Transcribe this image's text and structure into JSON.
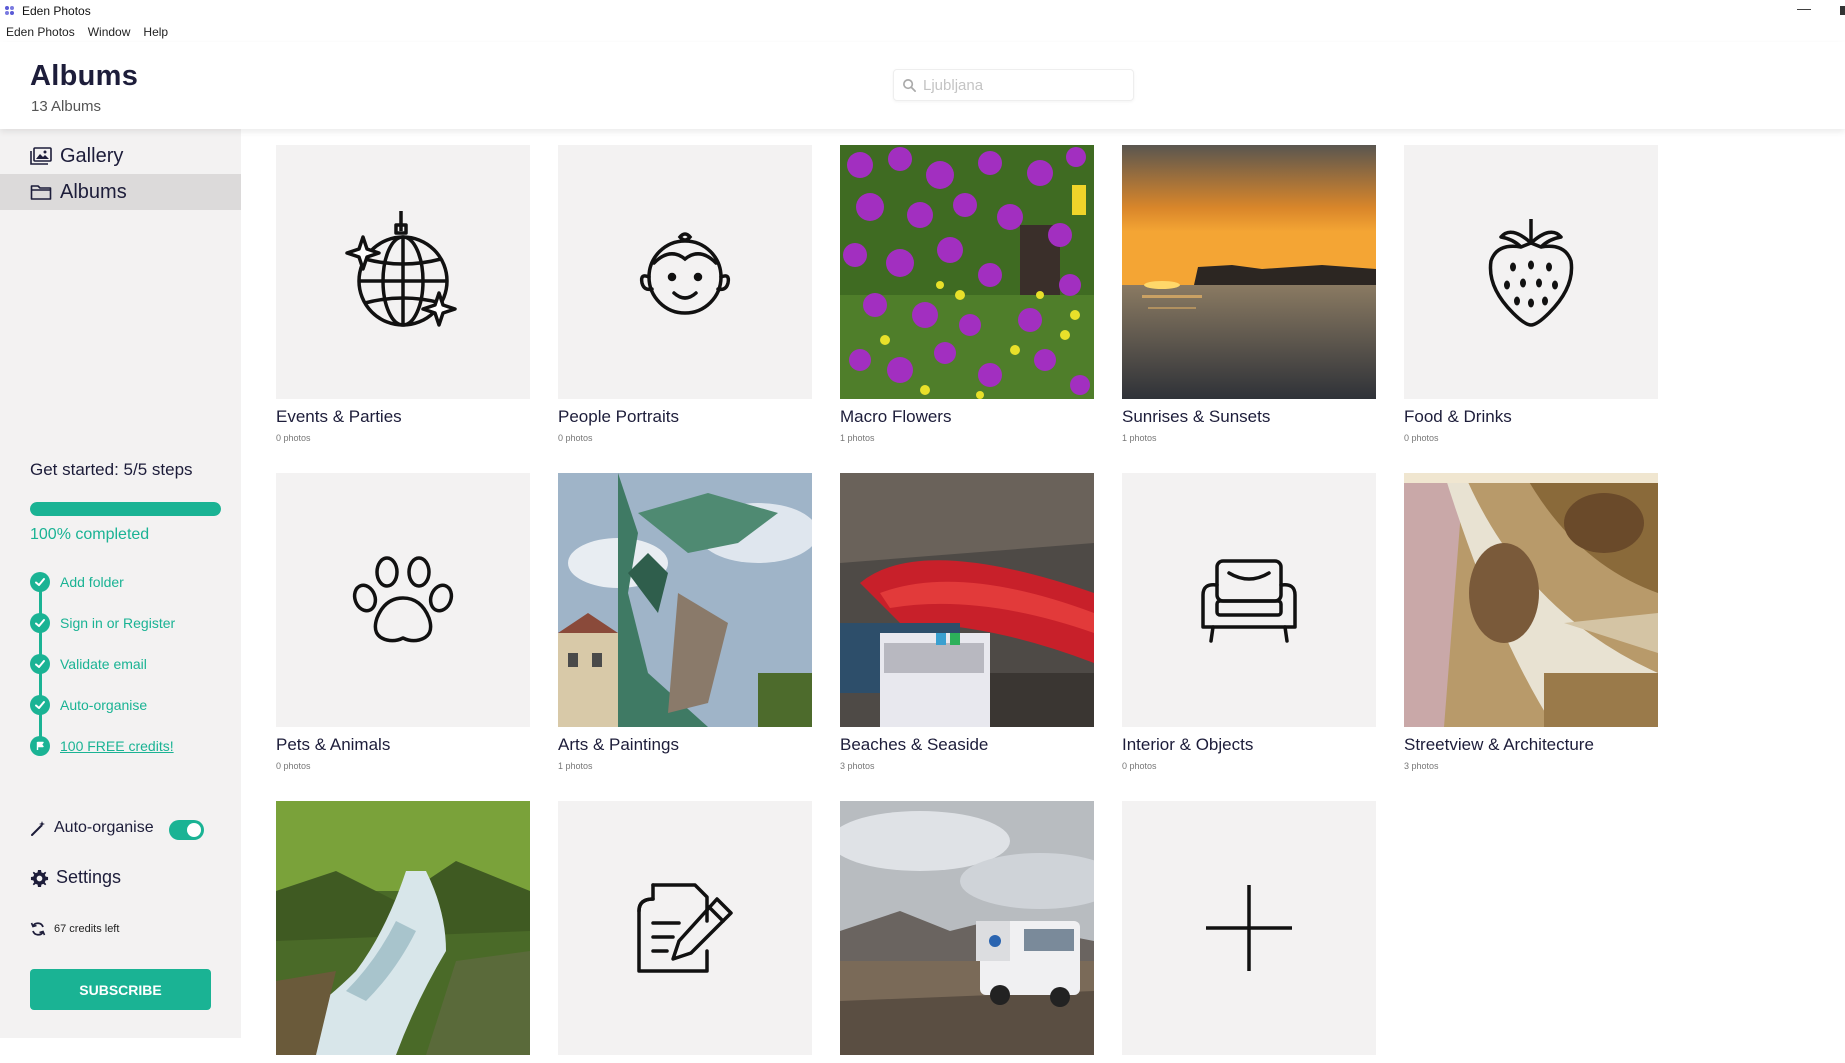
{
  "app": {
    "title": "Eden Photos",
    "menu": [
      "Eden Photos",
      "Window",
      "Help"
    ]
  },
  "header": {
    "title": "Albums",
    "subtitle": "13 Albums",
    "search": {
      "placeholder": "Ljubljana",
      "value": ""
    }
  },
  "sidebar": {
    "nav": [
      {
        "label": "Gallery",
        "icon": "gallery-icon",
        "active": false
      },
      {
        "label": "Albums",
        "icon": "folder-icon",
        "active": true
      }
    ],
    "get_started": {
      "title": "Get started: 5/5 steps",
      "progress": 1.0,
      "progress_text": "100% completed",
      "steps": [
        {
          "label": "Add folder",
          "done": true
        },
        {
          "label": "Sign in or Register",
          "done": true
        },
        {
          "label": "Validate email",
          "done": true
        },
        {
          "label": "Auto-organise",
          "done": true
        },
        {
          "label": "100 FREE credits!",
          "done": true
        }
      ]
    },
    "auto_organise": {
      "label": "Auto-organise",
      "enabled": true
    },
    "settings_label": "Settings",
    "credits_label": "67 credits left",
    "subscribe_label": "SUBSCRIBE"
  },
  "colors": {
    "accent": "#1ab394",
    "sidebar_bg": "#f3f2f2",
    "active_nav": "#dcdada"
  },
  "albums": [
    {
      "name": "Events & Parties",
      "count": "0 photos",
      "thumb": "disco-ball-icon"
    },
    {
      "name": "People Portraits",
      "count": "0 photos",
      "thumb": "child-face-icon"
    },
    {
      "name": "Macro Flowers",
      "count": "1 photos",
      "thumb": "photo-purple-flowers"
    },
    {
      "name": "Sunrises & Sunsets",
      "count": "1 photos",
      "thumb": "photo-sunset-sea"
    },
    {
      "name": "Food & Drinks",
      "count": "0 photos",
      "thumb": "strawberry-icon"
    },
    {
      "name": "Pets & Animals",
      "count": "0 photos",
      "thumb": "paw-icon"
    },
    {
      "name": "Arts & Paintings",
      "count": "1 photos",
      "thumb": "photo-dragon-statue"
    },
    {
      "name": "Beaches & Seaside",
      "count": "3 photos",
      "thumb": "photo-red-boat"
    },
    {
      "name": "Interior & Objects",
      "count": "0 photos",
      "thumb": "armchair-icon"
    },
    {
      "name": "Streetview & Architecture",
      "count": "3 photos",
      "thumb": "photo-baroque-ceiling"
    },
    {
      "name": "",
      "count": "",
      "thumb": "photo-forest-river"
    },
    {
      "name": "",
      "count": "",
      "thumb": "document-edit-icon"
    },
    {
      "name": "",
      "count": "",
      "thumb": "photo-truck-landscape"
    },
    {
      "name": "",
      "count": "",
      "thumb": "plus-icon"
    }
  ]
}
